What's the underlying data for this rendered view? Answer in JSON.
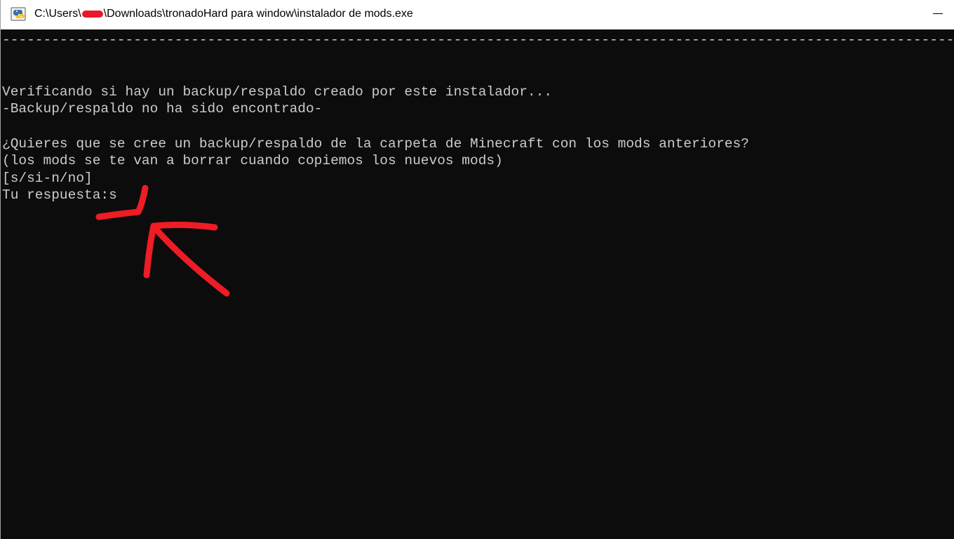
{
  "window": {
    "title_prefix": "C:\\Users\\",
    "title_suffix": "\\Downloads\\tronadoHard para window\\instalador de mods.exe",
    "icon": "python-app-icon",
    "controls": [
      "minimize"
    ]
  },
  "console": {
    "lines": [
      "------------------------------------------------------------------------------------------------------------------------",
      "",
      "",
      "Verificando si hay un backup/respaldo creado por este instalador...",
      "-Backup/respaldo no ha sido encontrado-",
      "",
      "¿Quieres que se cree un backup/respaldo de la carpeta de Minecraft con los mods anteriores?",
      "(los mods se te van a borrar cuando copiemos los nuevos mods)",
      "[s/si-n/no]",
      "Tu respuesta:s"
    ]
  },
  "colors": {
    "console_bg": "#0c0c0c",
    "console_text": "#cccccc",
    "titlebar_bg": "#ffffff",
    "annotation": "#ee1c24"
  }
}
